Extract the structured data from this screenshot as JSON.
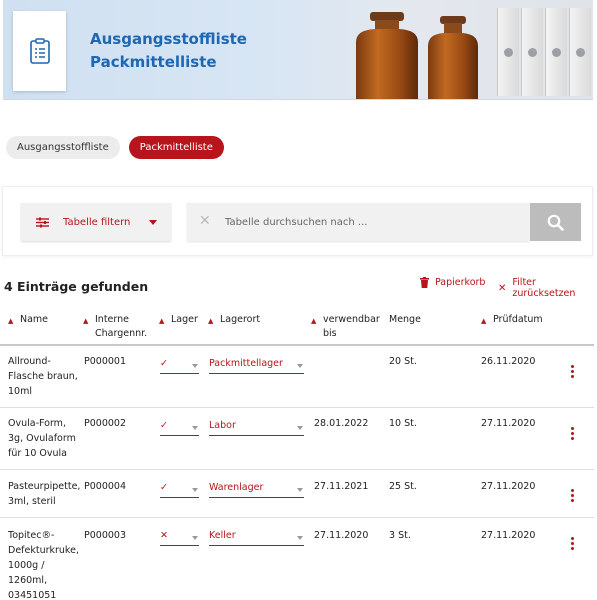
{
  "header": {
    "title_line1": "Ausgangsstoffliste",
    "title_line2": "Packmittelliste"
  },
  "tabs": [
    {
      "label": "Ausgangsstoffliste",
      "active": false
    },
    {
      "label": "Packmittelliste",
      "active": true
    }
  ],
  "filter": {
    "button_label": "Tabelle filtern",
    "search_placeholder": "Tabelle durchsuchen nach ..."
  },
  "results": {
    "count_text": "4 Einträge gefunden",
    "trash_label": "Papierkorb",
    "reset_label": "Filter zurücksetzen"
  },
  "table": {
    "headers": {
      "name": "Name",
      "charge": "Interne Chargennr.",
      "lager": "Lager",
      "lagerort": "Lagerort",
      "verwendbar": "verwendbar bis",
      "menge": "Menge",
      "pruefdatum": "Prüfdatum"
    },
    "rows": [
      {
        "name": "Allround-Flasche braun, 10ml",
        "charge": "P000001",
        "lager": "✓",
        "lagerort": "Packmittellager",
        "verwendbar": "",
        "menge": "20 St.",
        "pruefdatum": "26.11.2020"
      },
      {
        "name": "Ovula-Form, 3g, Ovulaform für 10 Ovula",
        "charge": "P000002",
        "lager": "✓",
        "lagerort": "Labor",
        "verwendbar": "28.01.2022",
        "menge": "10 St.",
        "pruefdatum": "27.11.2020"
      },
      {
        "name": "Pasteurpipette, 3ml, steril",
        "charge": "P000004",
        "lager": "✓",
        "lagerort": "Warenlager",
        "verwendbar": "27.11.2021",
        "menge": "25 St.",
        "pruefdatum": "27.11.2020"
      },
      {
        "name": "Topitec®-Defekturkruke, 1000g / 1260ml, 03451051",
        "charge": "P000003",
        "lager": "✕",
        "lagerort": "Keller",
        "verwendbar": "27.11.2020",
        "menge": "3 St.",
        "pruefdatum": "27.11.2020"
      }
    ]
  },
  "colors": {
    "accent": "#b8141b",
    "brand_blue": "#1d67b3"
  }
}
